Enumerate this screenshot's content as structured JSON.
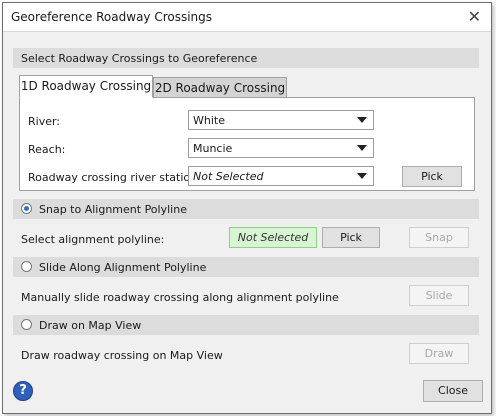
{
  "window": {
    "title": "Georeference Roadway Crossings"
  },
  "select_section": {
    "title": "Select Roadway Crossings to Georeference"
  },
  "tabs": [
    {
      "label": "1D Roadway Crossing"
    },
    {
      "label": "2D Roadway Crossing"
    }
  ],
  "form": {
    "river_label": "River:",
    "river_value": "White",
    "reach_label": "Reach:",
    "reach_value": "Muncie",
    "station_label": "Roadway crossing river station:",
    "station_value": "Not Selected",
    "pick_label": "Pick"
  },
  "snap_section": {
    "title": "Snap to Alignment Polyline",
    "prompt": "Select alignment polyline:",
    "status": "Not Selected",
    "pick_label": "Pick",
    "snap_label": "Snap"
  },
  "slide_section": {
    "title": "Slide Along Alignment Polyline",
    "prompt": "Manually slide roadway crossing along alignment polyline",
    "slide_label": "Slide"
  },
  "draw_section": {
    "title": "Draw on Map View",
    "prompt": "Draw roadway crossing on Map View",
    "draw_label": "Draw"
  },
  "footer": {
    "help_glyph": "?",
    "close_label": "Close"
  },
  "colors": {
    "status_ok_bg": "#d8f5d3",
    "accent": "#2f61b8"
  }
}
